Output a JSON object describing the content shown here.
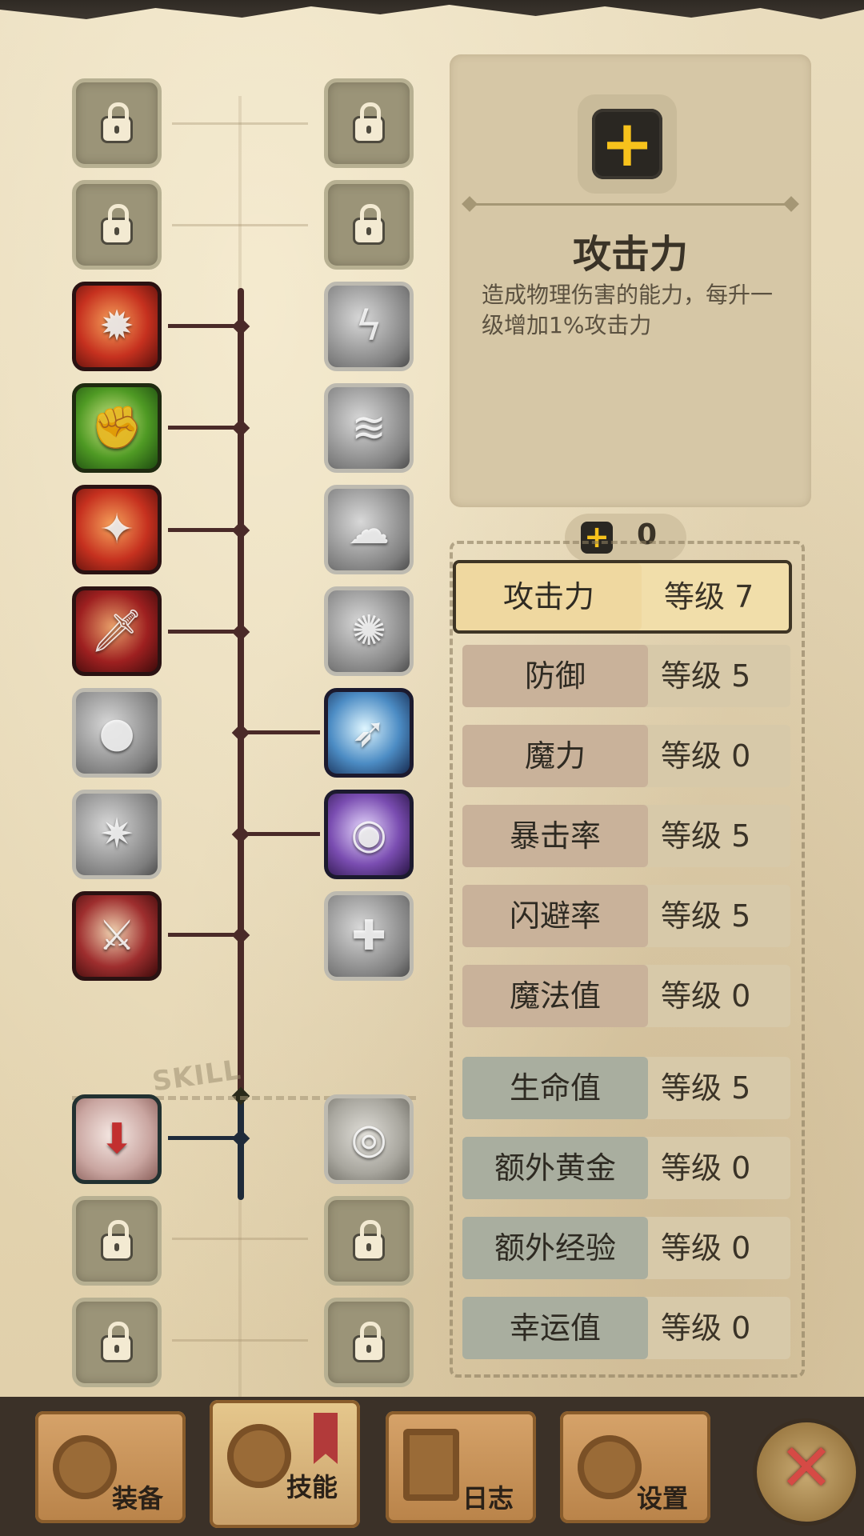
{
  "skill_tree": {
    "watermark": "SKILL",
    "left_column": [
      {
        "state": "locked",
        "icon": "lock-icon"
      },
      {
        "state": "locked",
        "icon": "lock-icon"
      },
      {
        "state": "unlocked",
        "icon": "fire-rage-icon",
        "color": "#c6311f"
      },
      {
        "state": "unlocked",
        "icon": "muscle-arm-icon",
        "color": "#4f9a24"
      },
      {
        "state": "unlocked",
        "icon": "strike-icon",
        "color": "#c6311f"
      },
      {
        "state": "unlocked",
        "icon": "dagger-icon",
        "color": "#8a1a1a"
      },
      {
        "state": "inactive",
        "icon": "dash-figure-icon"
      },
      {
        "state": "inactive",
        "icon": "shatter-icon"
      },
      {
        "state": "unlocked",
        "icon": "crossed-swords-icon",
        "color": "#8a1a1a"
      },
      {
        "state": "unlocked",
        "icon": "cauldron-icon",
        "color": "#c6311f"
      },
      {
        "state": "locked",
        "icon": "lock-icon"
      },
      {
        "state": "locked",
        "icon": "lock-icon"
      }
    ],
    "right_column": [
      {
        "state": "locked",
        "icon": "lock-icon"
      },
      {
        "state": "locked",
        "icon": "lock-icon"
      },
      {
        "state": "inactive",
        "icon": "lightning-icon"
      },
      {
        "state": "inactive",
        "icon": "speed-dash-icon"
      },
      {
        "state": "inactive",
        "icon": "smoke-icon"
      },
      {
        "state": "inactive",
        "icon": "burst-icon"
      },
      {
        "state": "unlocked",
        "icon": "wind-blade-icon",
        "color": "#4c8cc4"
      },
      {
        "state": "unlocked",
        "icon": "dark-orb-icon",
        "color": "#7a4db1"
      },
      {
        "state": "inactive",
        "icon": "sparkle-figure-icon"
      },
      {
        "state": "inactive",
        "icon": "eye-icon"
      },
      {
        "state": "locked",
        "icon": "lock-icon"
      },
      {
        "state": "locked",
        "icon": "lock-icon"
      }
    ]
  },
  "description": {
    "icon": "plus-icon",
    "title": "攻击力",
    "text": "造成物理伤害的能力，每升一级增加1%攻击力"
  },
  "points": {
    "icon": "plus-icon",
    "value": "0"
  },
  "stats": [
    {
      "name": "攻击力",
      "level": "等级 7",
      "selected": true
    },
    {
      "name": "防御",
      "level": "等级 5"
    },
    {
      "name": "魔力",
      "level": "等级 0"
    },
    {
      "name": "暴击率",
      "level": "等级 5"
    },
    {
      "name": "闪避率",
      "level": "等级 5"
    },
    {
      "name": "魔法值",
      "level": "等级 0"
    },
    {
      "name": "生命值",
      "level": "等级 5"
    },
    {
      "name": "额外黄金",
      "level": "等级 0"
    },
    {
      "name": "额外经验",
      "level": "等级 0"
    },
    {
      "name": "幸运值",
      "level": "等级 0"
    }
  ],
  "tabs": [
    {
      "label": "装备",
      "icon": "axe-icon"
    },
    {
      "label": "技能",
      "icon": "skill-ring-icon",
      "active": true
    },
    {
      "label": "日志",
      "icon": "journal-icon"
    },
    {
      "label": "设置",
      "icon": "gear-icon"
    }
  ],
  "close": {
    "icon": "close-icon",
    "glyph": "✕"
  },
  "colors": {
    "accent": "#f7c21c",
    "close": "#d64a45",
    "selected_row": "#f1deaa"
  }
}
